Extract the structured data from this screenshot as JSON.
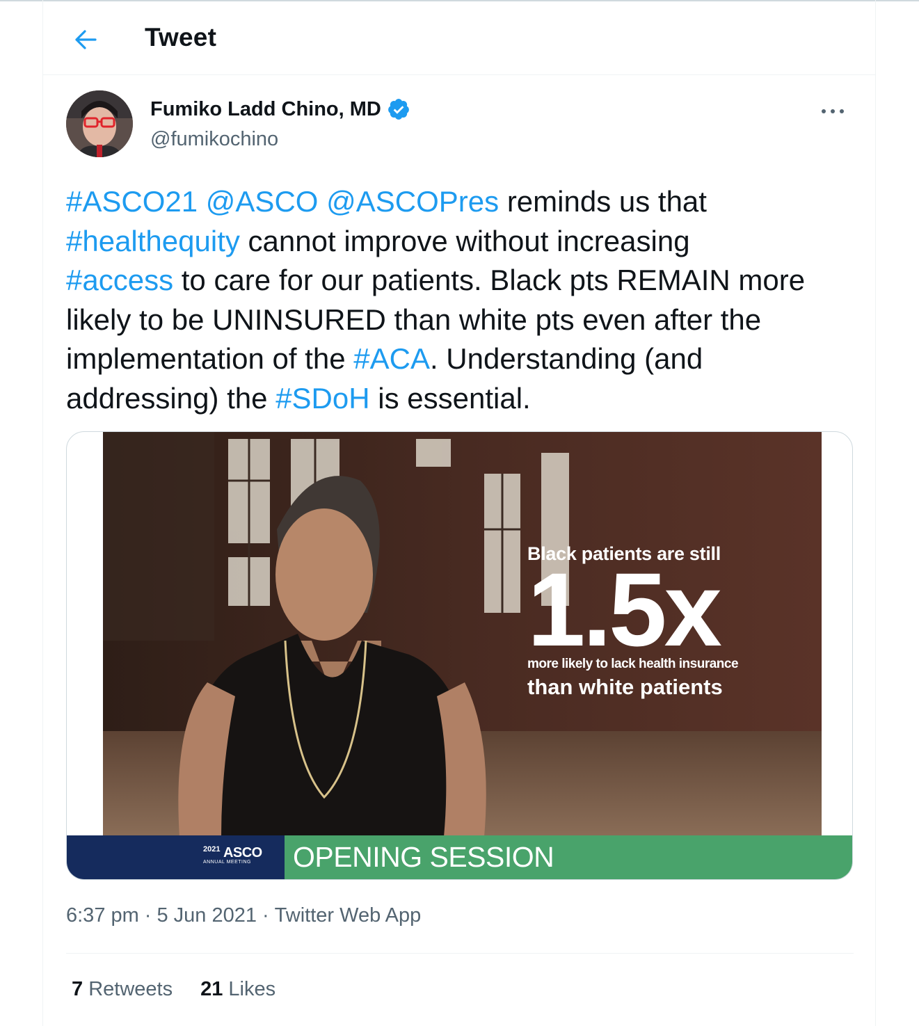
{
  "header": {
    "title": "Tweet",
    "back_icon": "arrow-left-icon"
  },
  "author": {
    "name": "Fumiko Ladd Chino, MD",
    "handle": "@fumikochino",
    "verified": true,
    "verified_icon": "verified-badge-icon",
    "more_icon": "more-dots-icon"
  },
  "tweet": {
    "lines": [
      [
        {
          "t": "#ASCO21",
          "link": true
        },
        {
          "t": " "
        },
        {
          "t": "@ASCO",
          "link": true
        },
        {
          "t": " "
        },
        {
          "t": "@ASCOPres",
          "link": true
        },
        {
          "t": " reminds us that"
        }
      ],
      [
        {
          "t": "#healthequity",
          "link": true
        },
        {
          "t": " cannot improve without increasing"
        }
      ],
      [
        {
          "t": "#access",
          "link": true
        },
        {
          "t": " to care for our patients. Black pts REMAIN more"
        }
      ],
      [
        {
          "t": "likely to be UNINSURED than white pts even after the"
        }
      ],
      [
        {
          "t": "implementation of the "
        },
        {
          "t": "#ACA",
          "link": true
        },
        {
          "t": ". Understanding (and"
        }
      ],
      [
        {
          "t": "addressing) the "
        },
        {
          "t": "#SDoH",
          "link": true
        },
        {
          "t": " is essential."
        }
      ]
    ]
  },
  "media": {
    "overlay": {
      "line1": "Black patients are still",
      "big": "1.5x",
      "line3": "more likely to lack health insurance",
      "line4": "than white patients"
    },
    "banner": {
      "logo_year": "2021",
      "logo_word": "ASCO",
      "logo_sub": "ANNUAL MEETING",
      "label": "OPENING SESSION"
    }
  },
  "meta": {
    "time": "6:37 pm",
    "date": "5 Jun 2021",
    "source": "Twitter Web App",
    "separator": "·"
  },
  "stats": {
    "retweets_count": "7",
    "retweets_label": "Retweets",
    "likes_count": "21",
    "likes_label": "Likes"
  },
  "colors": {
    "link": "#1d9bf0",
    "banner_blue": "#152b5d",
    "banner_green": "#49a36b",
    "text": "#0f1419",
    "muted": "#536471"
  }
}
